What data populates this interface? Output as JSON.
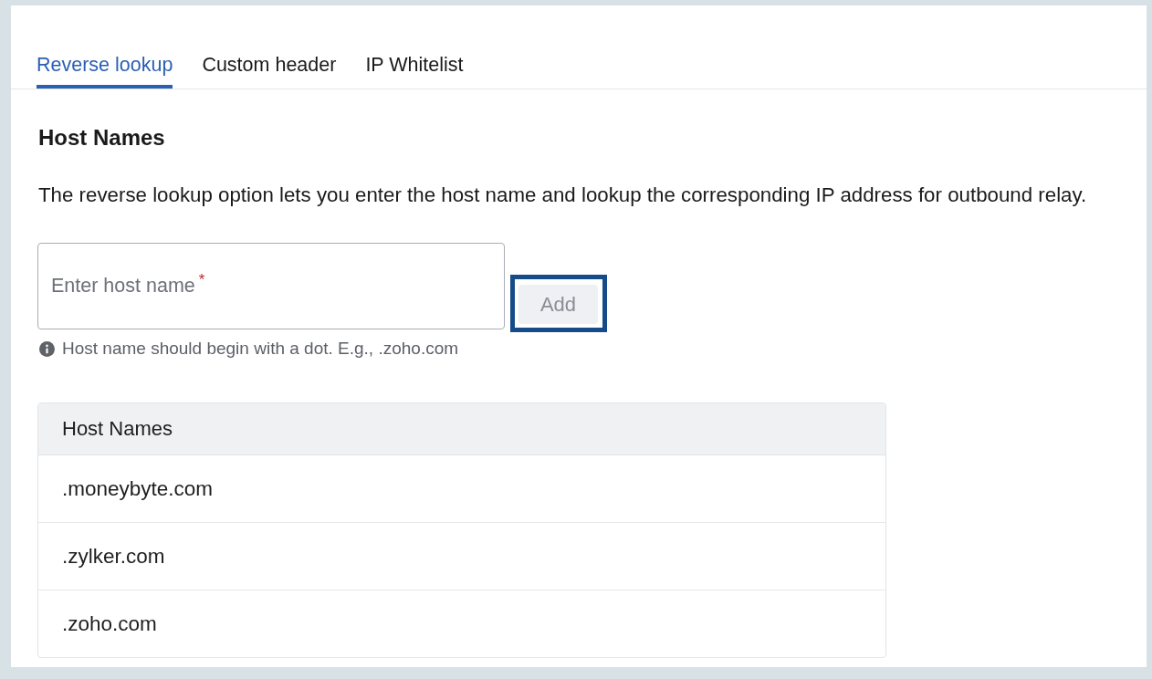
{
  "tabs": [
    {
      "label": "Reverse lookup",
      "selected": true
    },
    {
      "label": "Custom header",
      "selected": false
    },
    {
      "label": "IP Whitelist",
      "selected": false
    }
  ],
  "section": {
    "title": "Host Names",
    "description": "The reverse lookup option lets you enter the host name and lookup the corresponding IP address for outbound relay."
  },
  "host_input": {
    "placeholder": "Enter host name",
    "required_mark": "*"
  },
  "add_button": {
    "label": "Add",
    "disabled": true,
    "highlighted": true
  },
  "hint": {
    "text": "Host name should begin with a dot. E.g., .zoho.com"
  },
  "table": {
    "columns": [
      "Host Names"
    ],
    "rows": [
      [
        ".moneybyte.com"
      ],
      [
        ".zylker.com"
      ],
      [
        ".zoho.com"
      ]
    ]
  }
}
